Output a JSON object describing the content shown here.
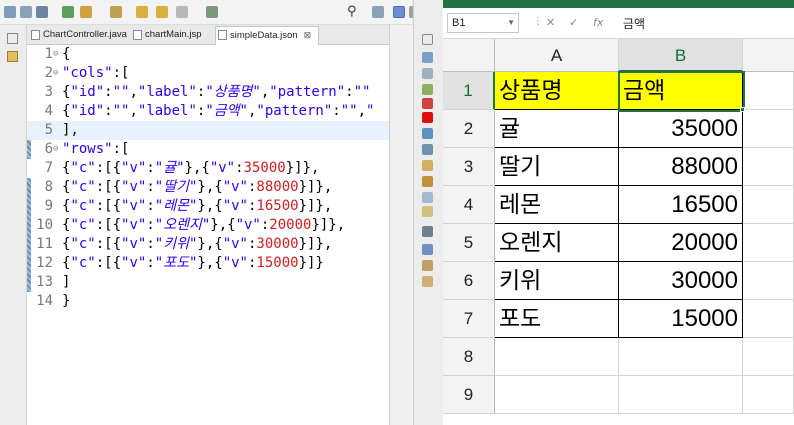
{
  "eclipse": {
    "tabs": [
      {
        "label": "ChartController.java",
        "active": false
      },
      {
        "label": "chartMain.jsp",
        "active": false
      },
      {
        "label": "simpleData.json",
        "active": true
      }
    ],
    "tab_close": "⊠",
    "search_icon": "search-icon",
    "code_lines": [
      {
        "n": "1",
        "fold": "⊖",
        "html": "{"
      },
      {
        "n": "2",
        "fold": "⊖",
        "html": "<span class='s'>\"cols\"</span>:["
      },
      {
        "n": "3",
        "fold": "",
        "html": "{<span class='s'>\"id\"</span>:<span class='s'>\"\"</span>,<span class='s'>\"label\"</span>:<span class='i'>\"상품명\"</span>,<span class='s'>\"pattern\"</span>:<span class='s'>\"\"</span>"
      },
      {
        "n": "4",
        "fold": "",
        "html": "{<span class='s'>\"id\"</span>:<span class='s'>\"\"</span>,<span class='s'>\"label\"</span>:<span class='i'>\"금액\"</span>,<span class='s'>\"pattern\"</span>:<span class='s'>\"\"</span>,<span class='s'>\"</span>"
      },
      {
        "n": "5",
        "fold": "",
        "html": "],",
        "current": true
      },
      {
        "n": "6",
        "fold": "⊖",
        "html": "<span class='s'>\"rows\"</span>:["
      },
      {
        "n": "7",
        "fold": "",
        "html": "{<span class='s'>\"c\"</span>:[{<span class='s'>\"v\"</span>:<span class='i'>\"귤\"</span>},{<span class='s'>\"v\"</span>:<span class='n'>35000</span>}]},"
      },
      {
        "n": "8",
        "fold": "",
        "html": "{<span class='s'>\"c\"</span>:[{<span class='s'>\"v\"</span>:<span class='i'>\"딸기\"</span>},{<span class='s'>\"v\"</span>:<span class='n'>88000</span>}]},"
      },
      {
        "n": "9",
        "fold": "",
        "html": "{<span class='s'>\"c\"</span>:[{<span class='s'>\"v\"</span>:<span class='i'>\"레몬\"</span>},{<span class='s'>\"v\"</span>:<span class='n'>16500</span>}]},"
      },
      {
        "n": "10",
        "fold": "",
        "html": "{<span class='s'>\"c\"</span>:[{<span class='s'>\"v\"</span>:<span class='i'>\"오렌지\"</span>},{<span class='s'>\"v\"</span>:<span class='n'>20000</span>}]},"
      },
      {
        "n": "11",
        "fold": "",
        "html": "{<span class='s'>\"c\"</span>:[{<span class='s'>\"v\"</span>:<span class='i'>\"키위\"</span>},{<span class='s'>\"v\"</span>:<span class='n'>30000</span>}]},"
      },
      {
        "n": "12",
        "fold": "",
        "html": "{<span class='s'>\"c\"</span>:[{<span class='s'>\"v\"</span>:<span class='i'>\"포도\"</span>},{<span class='s'>\"v\"</span>:<span class='n'>15000</span>}]}"
      },
      {
        "n": "13",
        "fold": "",
        "html": "]"
      },
      {
        "n": "14",
        "fold": "",
        "html": "}"
      }
    ]
  },
  "excel": {
    "name_box": "B1",
    "fx_cancel": "✕",
    "fx_enter": "✓",
    "fx_label": "fx",
    "formula_value": "금액",
    "columns": [
      "A",
      "B"
    ],
    "rows": [
      "1",
      "2",
      "3",
      "4",
      "5",
      "6",
      "7",
      "8",
      "9"
    ],
    "cells": [
      [
        "상품명",
        "금액"
      ],
      [
        "귤",
        "35000"
      ],
      [
        "딸기",
        "88000"
      ],
      [
        "레몬",
        "16500"
      ],
      [
        "오렌지",
        "20000"
      ],
      [
        "키위",
        "30000"
      ],
      [
        "포도",
        "15000"
      ]
    ],
    "header_fill": "#ffff00",
    "accent": "#217346"
  }
}
